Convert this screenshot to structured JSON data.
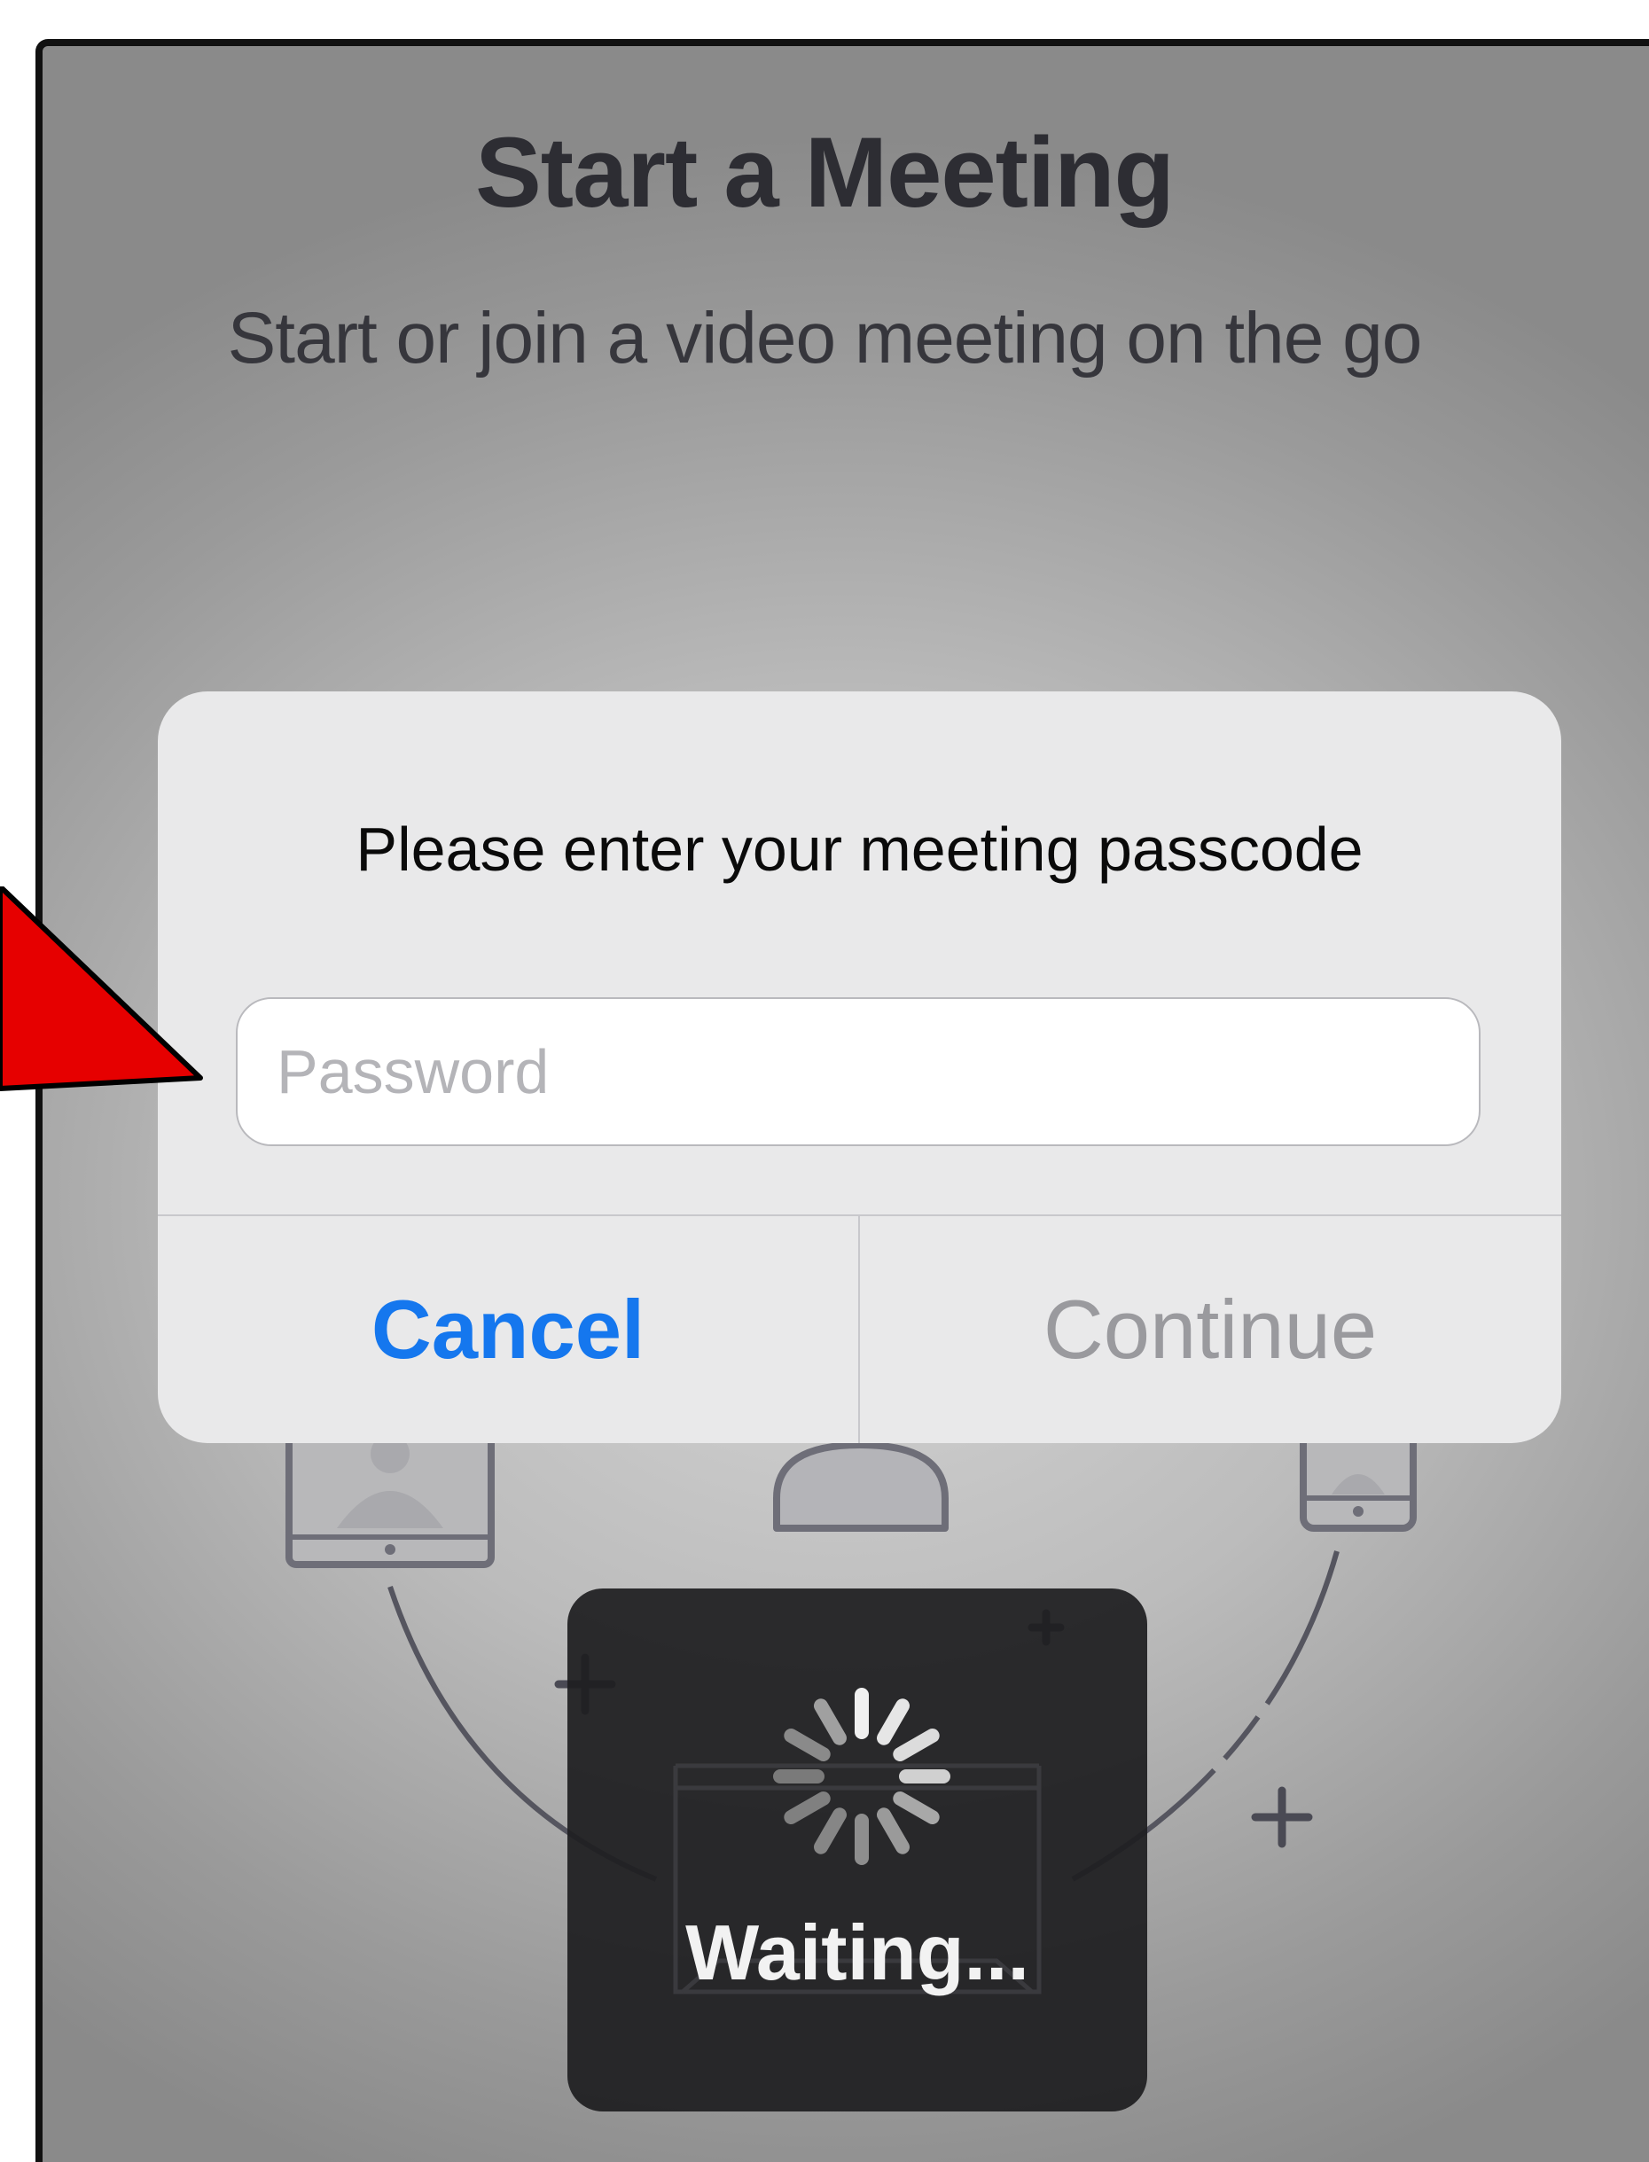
{
  "screen": {
    "title": "Start a Meeting",
    "subtitle": "Start or join a video meeting on the go"
  },
  "dialog": {
    "message": "Please enter your meeting passcode",
    "password_placeholder": "Password",
    "password_value": "",
    "cancel_label": "Cancel",
    "continue_label": "Continue"
  },
  "hud": {
    "waiting_label": "Waiting..."
  },
  "colors": {
    "accent": "#1577ee",
    "disabled": "#9a9a9e",
    "annotation_arrow": "#e60000"
  },
  "icons": [
    "spinner-icon",
    "tablet-icon",
    "phone-icon",
    "avatar-icon",
    "plus-icon",
    "annotation-arrow"
  ]
}
